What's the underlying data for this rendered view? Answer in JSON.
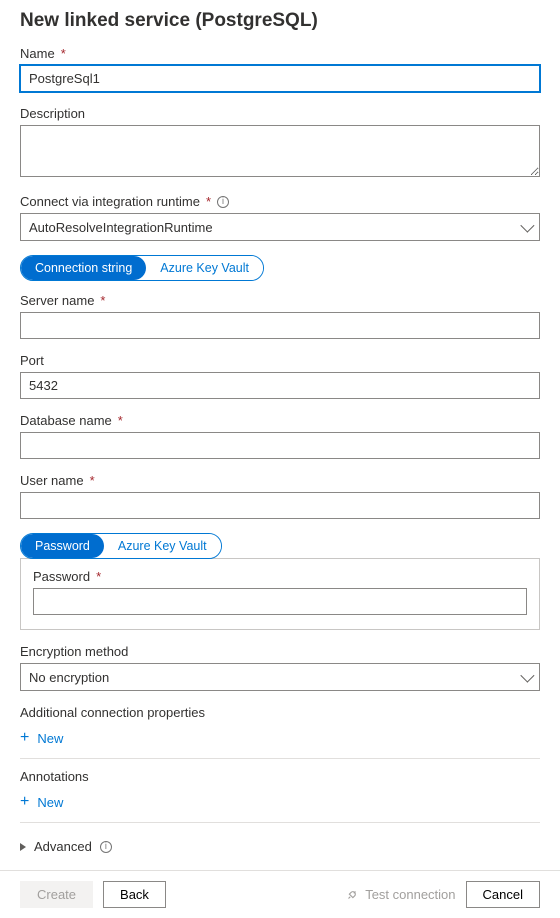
{
  "title": "New linked service (PostgreSQL)",
  "labels": {
    "name": "Name",
    "description": "Description",
    "runtime": "Connect via integration runtime",
    "server": "Server name",
    "port": "Port",
    "db": "Database name",
    "user": "User name",
    "password": "Password",
    "encryption": "Encryption method",
    "extraProps": "Additional connection properties",
    "annotations": "Annotations",
    "advanced": "Advanced"
  },
  "values": {
    "name": "PostgreSql1",
    "description": "",
    "runtime": "AutoResolveIntegrationRuntime",
    "server": "",
    "port": "5432",
    "db": "",
    "user": "",
    "password": "",
    "encryption": "No encryption"
  },
  "tabs": {
    "connection": {
      "connStr": "Connection string",
      "akv": "Azure Key Vault"
    },
    "password": {
      "pwd": "Password",
      "akv": "Azure Key Vault"
    }
  },
  "buttons": {
    "new": "New",
    "create": "Create",
    "back": "Back",
    "test": "Test connection",
    "cancel": "Cancel"
  }
}
